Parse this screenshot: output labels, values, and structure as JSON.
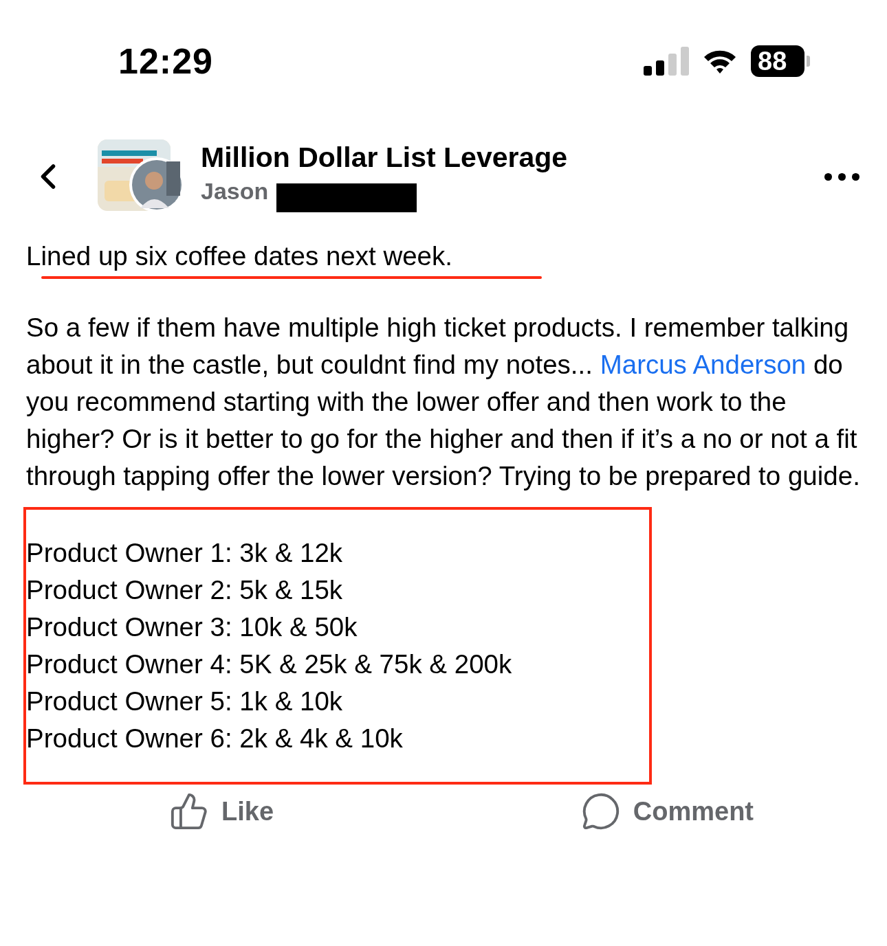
{
  "status_bar": {
    "time": "12:29",
    "battery": "88"
  },
  "header": {
    "group_name": "Million Dollar List Leverage",
    "author": "Jason"
  },
  "post": {
    "headline": "Lined up six coffee dates next week.",
    "paragraph": {
      "before": "So a few if them have multiple high ticket products. I remember talking about it in the castle, but couldnt find my notes... ",
      "mention": "Marcus Anderson",
      "after": " do you recommend starting with the lower offer and then work to the higher? Or is it better to go for the higher and then if it’s a no or not a fit through tapping offer the lower version? Trying to be prepared to guide."
    },
    "list": [
      "Product Owner 1: 3k & 12k",
      "Product Owner 2: 5k & 15k",
      "Product Owner 3: 10k & 50k",
      "Product Owner 4: 5K & 25k & 75k & 200k",
      "Product Owner 5: 1k & 10k",
      "Product Owner 6: 2k & 4k & 10k"
    ]
  },
  "actions": [
    {
      "kind": "like",
      "label": "Like"
    },
    {
      "kind": "comment",
      "label": "Comment"
    }
  ]
}
